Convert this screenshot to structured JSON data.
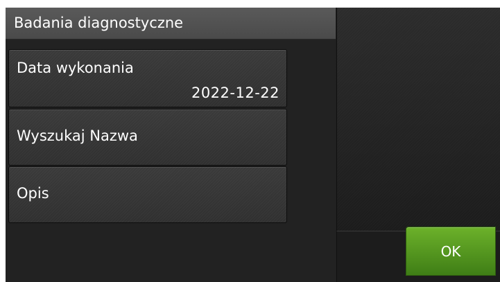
{
  "header": {
    "title": "Badania diagnostyczne"
  },
  "form": {
    "date": {
      "label": "Data wykonania",
      "value": "2022-12-22"
    },
    "search": {
      "label": "Wyszukaj Nazwa"
    },
    "description": {
      "label": "Opis"
    }
  },
  "actions": {
    "ok_label": "OK"
  },
  "colors": {
    "background": "#222222",
    "title_bar": "#505050",
    "field": "#353535",
    "ok_button": "#5a9e22",
    "text": "#ffffff"
  }
}
